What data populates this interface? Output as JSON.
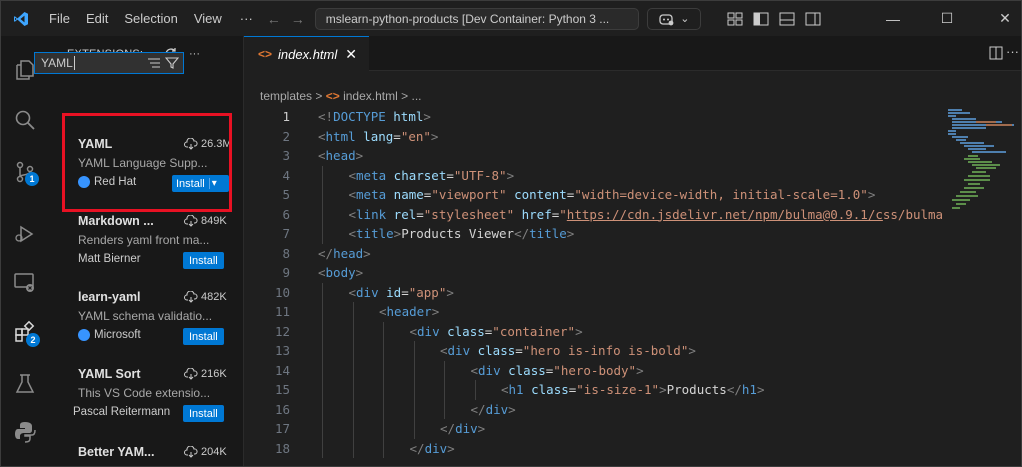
{
  "titlebar": {
    "menus": [
      "File",
      "Edit",
      "Selection",
      "View"
    ],
    "more": "···",
    "back_arrow": "←",
    "forward_arrow": "→",
    "command_center": "mslearn-python-products [Dev Container: Python 3 ...",
    "copilot_chevron": "⌄",
    "window_controls": {
      "minimize": "—",
      "maximize": "☐",
      "close": "✕"
    }
  },
  "activity_bar": {
    "items": [
      "explorer-icon",
      "search-icon",
      "source-control-icon",
      "run-debug-icon",
      "remote-explorer-icon",
      "extensions-icon",
      "testing-icon",
      "python-icon"
    ],
    "source_control_badge": "1",
    "extensions_badge": "2"
  },
  "sidebar": {
    "header": "EXTENSIONS: ...",
    "more": "···",
    "search_value": "YAML",
    "extensions": [
      {
        "name": "YAML",
        "downloads": "26.3M",
        "description": "YAML Language Supp...",
        "publisher": "Red Hat",
        "verified": true,
        "install": "Install",
        "has_dropdown": true
      },
      {
        "name": "Markdown ...",
        "downloads": "849K",
        "description": "Renders yaml front ma...",
        "publisher": "Matt Bierner",
        "verified": false,
        "install": "Install",
        "has_dropdown": false
      },
      {
        "name": "learn-yaml",
        "downloads": "482K",
        "description": "YAML schema validatio...",
        "publisher": "Microsoft",
        "verified": true,
        "install": "Install",
        "has_dropdown": false
      },
      {
        "name": "YAML Sort",
        "downloads": "216K",
        "description": "This VS Code extensio...",
        "publisher": "Pascal Reitermann",
        "verified": false,
        "install": "Install",
        "has_dropdown": false
      },
      {
        "name": "Better YAM...",
        "downloads": "204K",
        "description": "",
        "publisher": "",
        "verified": false,
        "install": "",
        "has_dropdown": false
      }
    ]
  },
  "editor": {
    "tab_label": "index.html",
    "tab_close": "✕",
    "breadcrumb": {
      "folder": "templates",
      "sep": ">",
      "file": "index.html",
      "tail": "> ..."
    },
    "lines": [
      {
        "n": "1",
        "indent": 0,
        "tokens": [
          [
            "br",
            "<!"
          ],
          [
            "tg",
            "DOCTYPE"
          ],
          [
            "at",
            " html"
          ],
          [
            "br",
            ">"
          ]
        ]
      },
      {
        "n": "2",
        "indent": 0,
        "tokens": [
          [
            "br",
            "<"
          ],
          [
            "tg",
            "html"
          ],
          [
            "at",
            " lang"
          ],
          [
            "tx",
            "="
          ],
          [
            "st",
            "\"en\""
          ],
          [
            "br",
            ">"
          ]
        ]
      },
      {
        "n": "3",
        "indent": 0,
        "tokens": [
          [
            "br",
            "<"
          ],
          [
            "tg",
            "head"
          ],
          [
            "br",
            ">"
          ]
        ]
      },
      {
        "n": "4",
        "indent": 1,
        "tokens": [
          [
            "br",
            "<"
          ],
          [
            "tg",
            "meta"
          ],
          [
            "at",
            " charset"
          ],
          [
            "tx",
            "="
          ],
          [
            "st",
            "\"UTF-8\""
          ],
          [
            "br",
            ">"
          ]
        ]
      },
      {
        "n": "5",
        "indent": 1,
        "tokens": [
          [
            "br",
            "<"
          ],
          [
            "tg",
            "meta"
          ],
          [
            "at",
            " name"
          ],
          [
            "tx",
            "="
          ],
          [
            "st",
            "\"viewport\""
          ],
          [
            "at",
            " content"
          ],
          [
            "tx",
            "="
          ],
          [
            "st",
            "\"width=device-width, initial-scale=1.0\""
          ],
          [
            "br",
            ">"
          ]
        ]
      },
      {
        "n": "6",
        "indent": 1,
        "tokens": [
          [
            "br",
            "<"
          ],
          [
            "tg",
            "link"
          ],
          [
            "at",
            " rel"
          ],
          [
            "tx",
            "="
          ],
          [
            "st",
            "\"stylesheet\""
          ],
          [
            "at",
            " href"
          ],
          [
            "tx",
            "="
          ],
          [
            "st",
            "\""
          ],
          [
            "lk",
            "https://cdn.jsdelivr.net/npm/bulma@0.9.1/c"
          ],
          [
            "st",
            "ss/bulma.m"
          ]
        ]
      },
      {
        "n": "7",
        "indent": 1,
        "tokens": [
          [
            "br",
            "<"
          ],
          [
            "tg",
            "title"
          ],
          [
            "br",
            ">"
          ],
          [
            "tx",
            "Products Viewer"
          ],
          [
            "br",
            "</"
          ],
          [
            "tg",
            "title"
          ],
          [
            "br",
            ">"
          ]
        ]
      },
      {
        "n": "8",
        "indent": 0,
        "tokens": [
          [
            "br",
            "</"
          ],
          [
            "tg",
            "head"
          ],
          [
            "br",
            ">"
          ]
        ]
      },
      {
        "n": "9",
        "indent": 0,
        "tokens": [
          [
            "br",
            "<"
          ],
          [
            "tg",
            "body"
          ],
          [
            "br",
            ">"
          ]
        ]
      },
      {
        "n": "10",
        "indent": 1,
        "tokens": [
          [
            "br",
            "<"
          ],
          [
            "tg",
            "div"
          ],
          [
            "at",
            " id"
          ],
          [
            "tx",
            "="
          ],
          [
            "st",
            "\"app\""
          ],
          [
            "br",
            ">"
          ]
        ]
      },
      {
        "n": "11",
        "indent": 2,
        "tokens": [
          [
            "br",
            "<"
          ],
          [
            "tg",
            "header"
          ],
          [
            "br",
            ">"
          ]
        ]
      },
      {
        "n": "12",
        "indent": 3,
        "tokens": [
          [
            "br",
            "<"
          ],
          [
            "tg",
            "div"
          ],
          [
            "at",
            " class"
          ],
          [
            "tx",
            "="
          ],
          [
            "st",
            "\"container\""
          ],
          [
            "br",
            ">"
          ]
        ]
      },
      {
        "n": "13",
        "indent": 4,
        "tokens": [
          [
            "br",
            "<"
          ],
          [
            "tg",
            "div"
          ],
          [
            "at",
            " class"
          ],
          [
            "tx",
            "="
          ],
          [
            "st",
            "\"hero is-info is-bold\""
          ],
          [
            "br",
            ">"
          ]
        ]
      },
      {
        "n": "14",
        "indent": 5,
        "tokens": [
          [
            "br",
            "<"
          ],
          [
            "tg",
            "div"
          ],
          [
            "at",
            " class"
          ],
          [
            "tx",
            "="
          ],
          [
            "st",
            "\"hero-body\""
          ],
          [
            "br",
            ">"
          ]
        ]
      },
      {
        "n": "15",
        "indent": 6,
        "tokens": [
          [
            "br",
            "<"
          ],
          [
            "tg",
            "h1"
          ],
          [
            "at",
            " class"
          ],
          [
            "tx",
            "="
          ],
          [
            "st",
            "\"is-size-1\""
          ],
          [
            "br",
            ">"
          ],
          [
            "tx",
            "Products"
          ],
          [
            "br",
            "</"
          ],
          [
            "tg",
            "h1"
          ],
          [
            "br",
            ">"
          ]
        ]
      },
      {
        "n": "16",
        "indent": 5,
        "tokens": [
          [
            "br",
            "</"
          ],
          [
            "tg",
            "div"
          ],
          [
            "br",
            ">"
          ]
        ]
      },
      {
        "n": "17",
        "indent": 4,
        "tokens": [
          [
            "br",
            "</"
          ],
          [
            "tg",
            "div"
          ],
          [
            "br",
            ">"
          ]
        ]
      },
      {
        "n": "18",
        "indent": 3,
        "tokens": [
          [
            "br",
            "</"
          ],
          [
            "tg",
            "div"
          ],
          [
            "br",
            ">"
          ]
        ]
      }
    ],
    "active_line": "1"
  },
  "colors": {
    "accent": "#0078d4",
    "highlight_border": "#e81123",
    "tag": "#569cd6",
    "attribute": "#9cdcfe",
    "string": "#ce9178"
  }
}
